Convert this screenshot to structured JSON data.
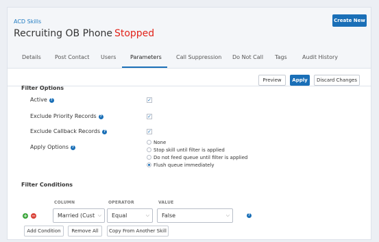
{
  "header": {
    "breadcrumb": "ACD Skills",
    "title": "Recruiting OB Phone",
    "status": "Stopped",
    "status_color": "#e2231a",
    "create_label": "Create New"
  },
  "tabs": [
    {
      "label": "Details"
    },
    {
      "label": "Post Contact"
    },
    {
      "label": "Users"
    },
    {
      "label": "Parameters"
    },
    {
      "label": "Call Suppression"
    },
    {
      "label": "Do Not Call"
    },
    {
      "label": "Tags"
    },
    {
      "label": "Audit History"
    }
  ],
  "active_tab": "Parameters",
  "toolbar": {
    "preview_label": "Preview",
    "apply_label": "Apply",
    "discard_label": "Discard Changes"
  },
  "filter_options": {
    "title": "Filter Options",
    "rows": [
      {
        "label": "Active",
        "checked": true,
        "help": true
      },
      {
        "label": "Exclude Priority Records",
        "checked": true,
        "help": true
      },
      {
        "label": "Exclude Callback Records",
        "checked": true,
        "help": true
      }
    ],
    "apply_options": {
      "label": "Apply Options",
      "options": [
        {
          "label": "None",
          "checked": false
        },
        {
          "label": "Stop skill until filter is applied",
          "checked": false
        },
        {
          "label": "Do not feed queue until filter is applied",
          "checked": false
        },
        {
          "label": "Flush queue immediately",
          "checked": true
        }
      ]
    }
  },
  "filter_conditions": {
    "title": "Filter Conditions",
    "columns": {
      "column": "COLUMN",
      "operator": "OPERATOR",
      "value": "VALUE"
    },
    "row": {
      "column": "Married (Custor",
      "operator": "Equal",
      "value": "False"
    },
    "add_label": "Add Condition",
    "remove_label": "Remove All",
    "copy_label": "Copy From Another Skill"
  },
  "icons": {
    "add": "plus-circle-icon",
    "remove": "minus-circle-icon",
    "help": "question-circle-icon",
    "chevron": "chevron-down-icon"
  },
  "colors": {
    "accent": "#1a6fb7",
    "add_green": "#3aa53a",
    "remove_red": "#d9443a"
  }
}
